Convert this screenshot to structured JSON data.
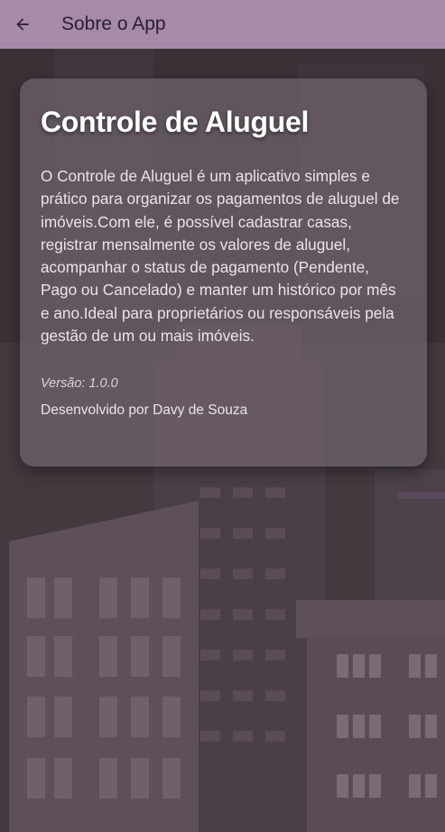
{
  "app_bar": {
    "back_icon": "arrow-left-icon",
    "title": "Sobre o App",
    "background_color": "#a68aa8"
  },
  "card": {
    "title": "Controle de Aluguel",
    "description": "O Controle de Aluguel é um aplicativo simples e prático para organizar os pagamentos de aluguel de imóveis.Com ele, é possível cadastrar casas, registrar mensalmente os valores de aluguel, acompanhar o status de pagamento (Pendente, Pago ou Cancelado) e manter um histórico por mês e ano.Ideal para proprietários ou responsáveis pela gestão de um ou mais imóveis.",
    "version": "Versão: 1.0.0",
    "developer": "Desenvolvido por Davy de Souza"
  },
  "background": {
    "illustration": "city-buildings-illustration",
    "base_color": "#3a3136"
  }
}
